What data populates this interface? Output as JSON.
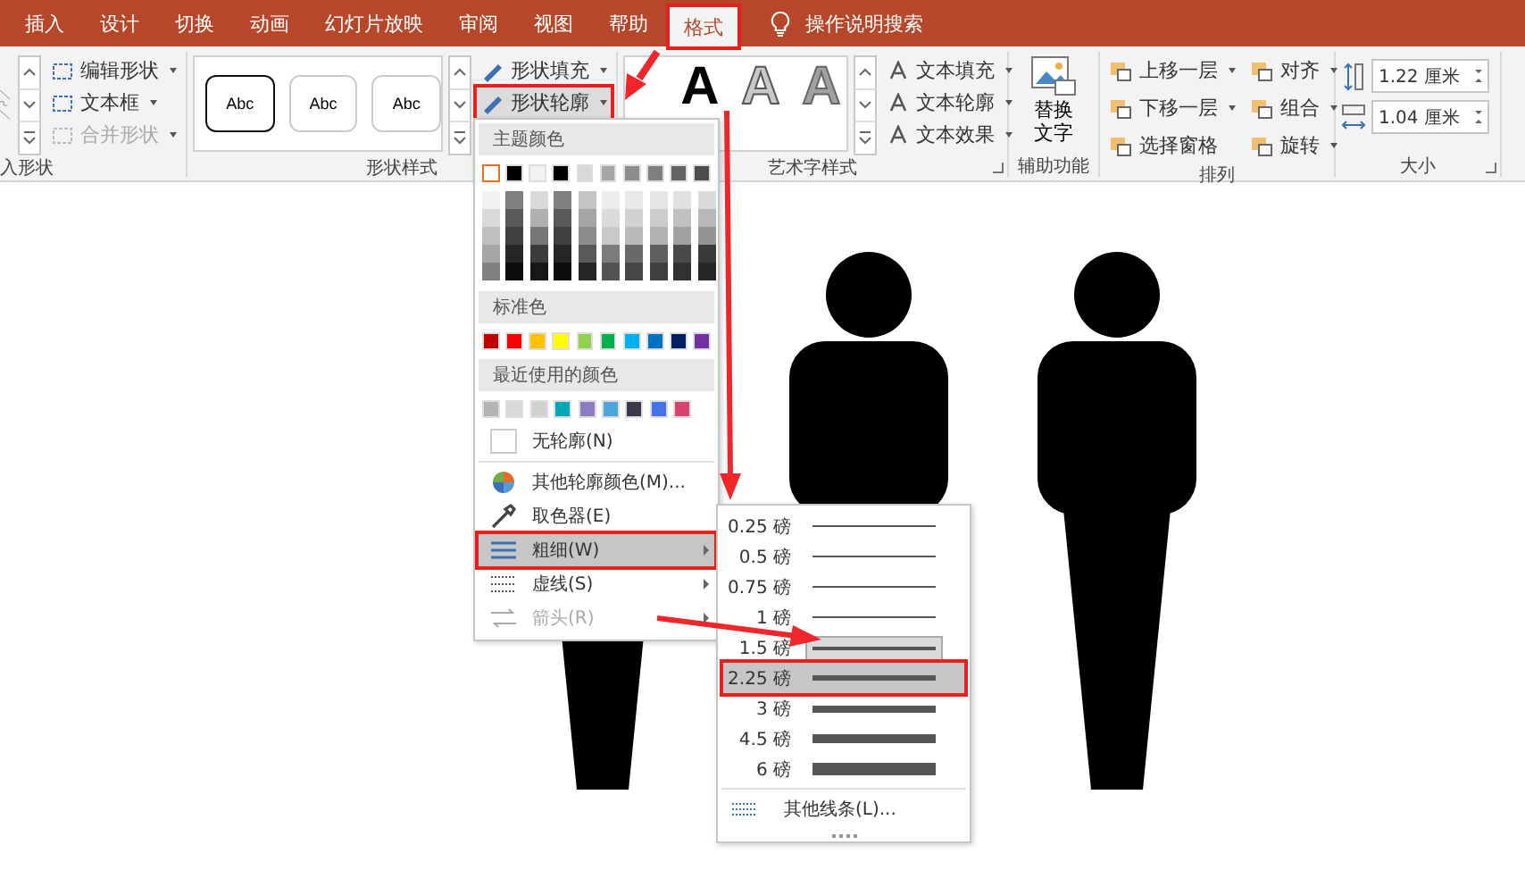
{
  "tabs": [
    {
      "label": "插入",
      "selected": false,
      "marked": false
    },
    {
      "label": "设计",
      "selected": false,
      "marked": false
    },
    {
      "label": "切换",
      "selected": false,
      "marked": false
    },
    {
      "label": "动画",
      "selected": false,
      "marked": false
    },
    {
      "label": "幻灯片放映",
      "selected": false,
      "marked": false
    },
    {
      "label": "审阅",
      "selected": false,
      "marked": false
    },
    {
      "label": "视图",
      "selected": false,
      "marked": false
    },
    {
      "label": "帮助",
      "selected": false,
      "marked": false
    },
    {
      "label": "格式",
      "selected": true,
      "marked": true
    }
  ],
  "search": {
    "label": "操作说明搜索"
  },
  "insert_shapes": {
    "title": "入形状",
    "commands": [
      {
        "label": "编辑形状",
        "disabled": false
      },
      {
        "label": "文本框",
        "disabled": false
      },
      {
        "label": "合并形状",
        "disabled": true
      }
    ]
  },
  "shape_styles": {
    "title": "形状样式",
    "presets": [
      "Abc",
      "Abc",
      "Abc"
    ],
    "commands": [
      {
        "label": "形状填充",
        "marked": false
      },
      {
        "label": "形状轮廓",
        "marked": true
      }
    ]
  },
  "wordart_styles": {
    "title": "艺术字样式",
    "presets": [
      "A",
      "A",
      "A"
    ],
    "commands": [
      "文本填充",
      "文本轮廓",
      "文本效果"
    ]
  },
  "accessibility": {
    "title": "辅助功能",
    "button": "替换文字"
  },
  "arrange": {
    "title": "排列",
    "commands": [
      "上移一层",
      "下移一层",
      "选择窗格",
      "对齐",
      "组合",
      "旋转"
    ]
  },
  "size": {
    "title": "大小",
    "height": "1.22 厘米",
    "width": "1.04 厘米"
  },
  "outline_menu": {
    "theme_title": "主题颜色",
    "theme_colors": [
      {
        "color": "#ffffff",
        "selected": true,
        "shades": [
          {
            "color": "#f2f2f2"
          },
          {
            "color": "#d9d9d9"
          },
          {
            "color": "#bfbfbf"
          },
          {
            "color": "#a6a6a6"
          },
          {
            "color": "#808080"
          }
        ]
      },
      {
        "color": "#000000",
        "selected": false,
        "shades": [
          {
            "color": "#808080"
          },
          {
            "color": "#595959"
          },
          {
            "color": "#404040"
          },
          {
            "color": "#262626"
          },
          {
            "color": "#0d0d0d"
          }
        ]
      },
      {
        "color": "#f2f2f2",
        "selected": false,
        "shades": [
          {
            "color": "#d9d9d9"
          },
          {
            "color": "#b0b0b0"
          },
          {
            "color": "#767676"
          },
          {
            "color": "#3b3b3b"
          },
          {
            "color": "#171717"
          }
        ]
      },
      {
        "color": "#000000",
        "selected": false,
        "shades": [
          {
            "color": "#808080"
          },
          {
            "color": "#595959"
          },
          {
            "color": "#404040"
          },
          {
            "color": "#262626"
          },
          {
            "color": "#0d0d0d"
          }
        ]
      },
      {
        "color": "#d9d9d9",
        "selected": false,
        "shades": [
          {
            "color": "#c4c4c4"
          },
          {
            "color": "#a6a6a6"
          },
          {
            "color": "#8c8c8c"
          },
          {
            "color": "#595959"
          },
          {
            "color": "#262626"
          }
        ]
      },
      {
        "color": "#a6a6a6",
        "selected": false,
        "shades": [
          {
            "color": "#ededed"
          },
          {
            "color": "#dbdbdb"
          },
          {
            "color": "#c9c9c9"
          },
          {
            "color": "#7c7c7c"
          },
          {
            "color": "#535353"
          }
        ]
      },
      {
        "color": "#8c8c8c",
        "selected": false,
        "shades": [
          {
            "color": "#e8e8e8"
          },
          {
            "color": "#d1d1d1"
          },
          {
            "color": "#bababa"
          },
          {
            "color": "#696969"
          },
          {
            "color": "#464646"
          }
        ]
      },
      {
        "color": "#7f7f7f",
        "selected": false,
        "shades": [
          {
            "color": "#e5e5e5"
          },
          {
            "color": "#cccccc"
          },
          {
            "color": "#b2b2b2"
          },
          {
            "color": "#5f5f5f"
          },
          {
            "color": "#3f3f3f"
          }
        ]
      },
      {
        "color": "#636363",
        "selected": false,
        "shades": [
          {
            "color": "#e0e0e0"
          },
          {
            "color": "#c1c1c1"
          },
          {
            "color": "#a1a1a1"
          },
          {
            "color": "#4a4a4a"
          },
          {
            "color": "#313131"
          }
        ]
      },
      {
        "color": "#4d4d4d",
        "selected": false,
        "shades": [
          {
            "color": "#dbdbdb"
          },
          {
            "color": "#b8b8b8"
          },
          {
            "color": "#949494"
          },
          {
            "color": "#3a3a3a"
          },
          {
            "color": "#262626"
          }
        ]
      }
    ],
    "standard_title": "标准色",
    "standard_colors": [
      {
        "color": "#c00000"
      },
      {
        "color": "#ff0000"
      },
      {
        "color": "#ffc000"
      },
      {
        "color": "#ffff00"
      },
      {
        "color": "#92d050"
      },
      {
        "color": "#00b050"
      },
      {
        "color": "#00b0f0"
      },
      {
        "color": "#0070c0"
      },
      {
        "color": "#002060"
      },
      {
        "color": "#7030a0"
      }
    ],
    "recent_title": "最近使用的颜色",
    "recent_colors": [
      {
        "color": "#b4b4b4"
      },
      {
        "color": "#d9d9d9"
      },
      {
        "color": "#d0d0d0"
      },
      {
        "color": "#00a8b5"
      },
      {
        "color": "#8e7cc3"
      },
      {
        "color": "#4ea5d9"
      },
      {
        "color": "#3a3a4a"
      },
      {
        "color": "#4472e8"
      },
      {
        "color": "#d9416e"
      }
    ],
    "items": [
      {
        "kind": "none",
        "label": "无轮廓(N)",
        "submenu": false,
        "selected": false,
        "disabled": false,
        "marked": false
      },
      {
        "kind": "more-colors",
        "label": "其他轮廓颜色(M)...",
        "submenu": false,
        "selected": false,
        "disabled": false,
        "marked": false
      },
      {
        "kind": "eyedropper",
        "label": "取色器(E)",
        "submenu": false,
        "selected": false,
        "disabled": false,
        "marked": false
      },
      {
        "kind": "weight",
        "label": "粗细(W)",
        "submenu": true,
        "selected": true,
        "disabled": false,
        "marked": true
      },
      {
        "kind": "dash",
        "label": "虚线(S)",
        "submenu": true,
        "selected": false,
        "disabled": false,
        "marked": false
      },
      {
        "kind": "arrow",
        "label": "箭头(R)",
        "submenu": true,
        "selected": false,
        "disabled": true,
        "marked": false
      }
    ]
  },
  "weight_menu": {
    "items": [
      {
        "label": "0.25 磅",
        "selected": false,
        "current": false,
        "marked": false
      },
      {
        "label": "0.5 磅",
        "selected": false,
        "current": false,
        "marked": false
      },
      {
        "label": "0.75 磅",
        "selected": false,
        "current": false,
        "marked": false
      },
      {
        "label": "1 磅",
        "selected": false,
        "current": false,
        "marked": false
      },
      {
        "label": "1.5 磅",
        "selected": false,
        "current": true,
        "marked": false
      },
      {
        "label": "2.25 磅",
        "selected": true,
        "current": false,
        "marked": true
      },
      {
        "label": "3 磅",
        "selected": false,
        "current": false,
        "marked": false
      },
      {
        "label": "4.5 磅",
        "selected": false,
        "current": false,
        "marked": false
      },
      {
        "label": "6 磅",
        "selected": false,
        "current": false,
        "marked": false
      }
    ],
    "more": "其他线条(L)..."
  }
}
